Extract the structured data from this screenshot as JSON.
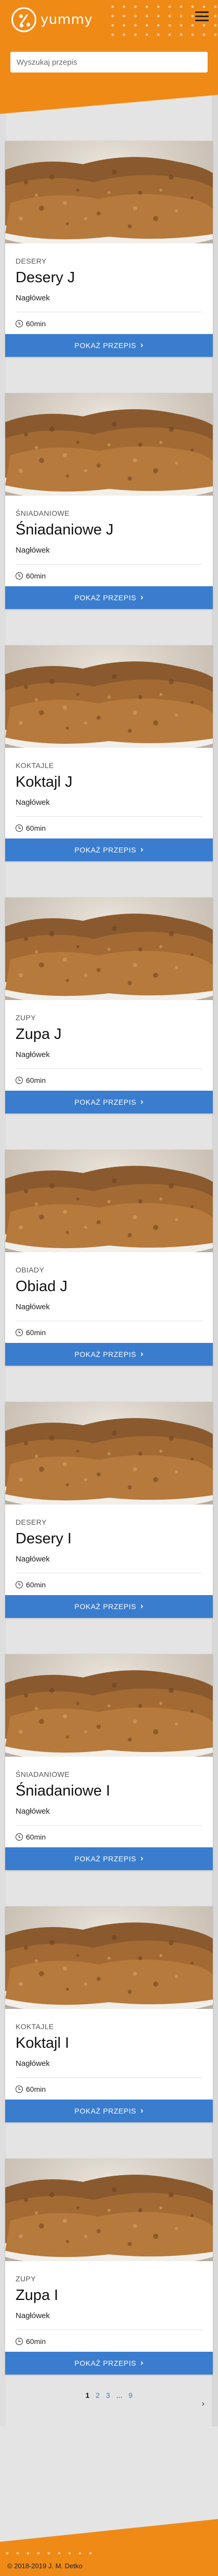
{
  "header": {
    "logo_text": "yummy",
    "search_placeholder": "Wyszukaj przepis"
  },
  "recipes": [
    {
      "category": "DESERY",
      "title": "Desery J",
      "subtitle": "Nagłówek",
      "time": "60min",
      "button": "POKAŻ PRZEPIS"
    },
    {
      "category": "ŚNIADANIOWE",
      "title": "Śniadaniowe J",
      "subtitle": "Nagłówek",
      "time": "60min",
      "button": "POKAŻ PRZEPIS"
    },
    {
      "category": "KOKTAJLE",
      "title": "Koktajl J",
      "subtitle": "Nagłówek",
      "time": "60min",
      "button": "POKAŻ PRZEPIS"
    },
    {
      "category": "ZUPY",
      "title": "Zupa J",
      "subtitle": "Nagłówek",
      "time": "60min",
      "button": "POKAŻ PRZEPIS"
    },
    {
      "category": "OBIADY",
      "title": "Obiad J",
      "subtitle": "Nagłówek",
      "time": "60min",
      "button": "POKAŻ PRZEPIS"
    },
    {
      "category": "DESERY",
      "title": "Desery I",
      "subtitle": "Nagłówek",
      "time": "60min",
      "button": "POKAŻ PRZEPIS"
    },
    {
      "category": "ŚNIADANIOWE",
      "title": "Śniadaniowe I",
      "subtitle": "Nagłówek",
      "time": "60min",
      "button": "POKAŻ PRZEPIS"
    },
    {
      "category": "KOKTAJLE",
      "title": "Koktajl I",
      "subtitle": "Nagłówek",
      "time": "60min",
      "button": "POKAŻ PRZEPIS"
    },
    {
      "category": "ZUPY",
      "title": "Zupa I",
      "subtitle": "Nagłówek",
      "time": "60min",
      "button": "POKAŻ PRZEPIS"
    }
  ],
  "pagination": {
    "pages": [
      "1",
      "2",
      "3"
    ],
    "ellipsis": "...",
    "last_page": "9",
    "next": "›"
  },
  "footer": {
    "copyright": "© 2018-2019 J. M. Detko"
  },
  "colors": {
    "brand_orange": "#f08a17",
    "button_blue": "#3a7dcf"
  }
}
